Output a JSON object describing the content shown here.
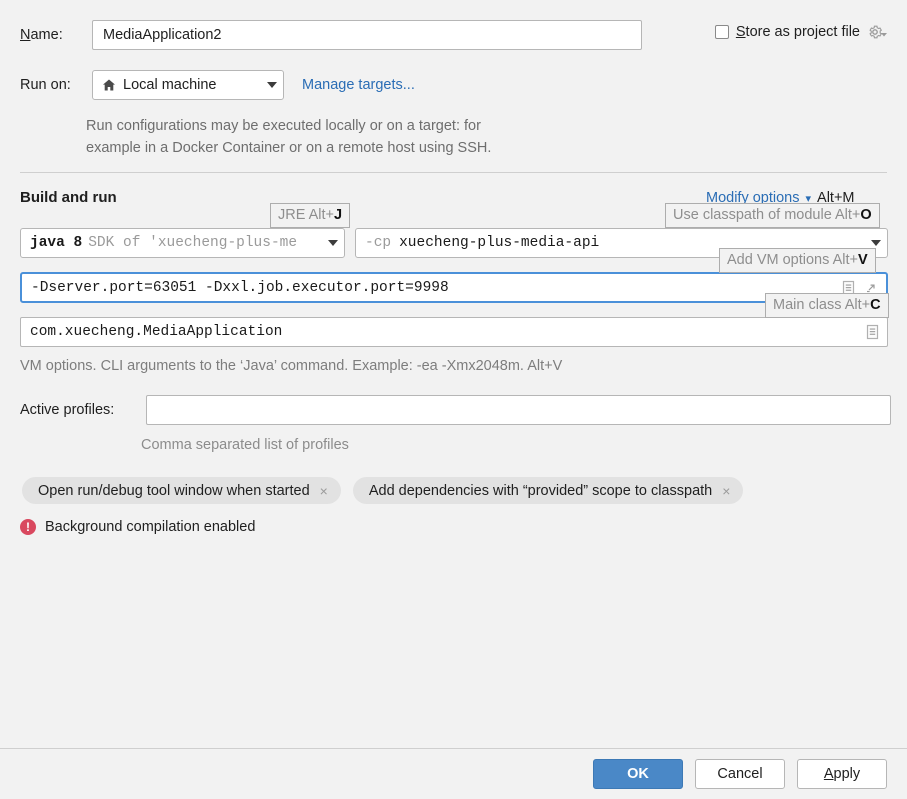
{
  "dialog": {
    "name_label": "Name:",
    "name_value": "MediaApplication2",
    "store_as_project_file": "Store as project file",
    "gear_icon": "gear-icon",
    "run_on_label": "Run on:",
    "run_on_value": "Local machine",
    "run_on_icon": "home-icon",
    "manage_targets": "Manage targets...",
    "helper_line1": "Run configurations may be executed locally or on a target: for",
    "helper_line2": "example in a Docker Container or on a remote host using SSH.",
    "section_title": "Build and run",
    "modify_options": {
      "link": "Modify options",
      "chevron": "chevron-down-icon",
      "shortcut": "Alt+M"
    },
    "jre": {
      "bold": "java 8",
      "dim": "SDK of 'xuecheng-plus-me"
    },
    "classpath": {
      "flag": "-cp",
      "module": "xuecheng-plus-media-api"
    },
    "vm_options_value": "-Dserver.port=63051 -Dxxl.job.executor.port=9998",
    "main_class_value": "com.xuecheng.MediaApplication",
    "vm_hint": "VM options. CLI arguments to the ‘Java’ command. Example: -ea -Xmx2048m. Alt+V",
    "active_profiles_label": "Active profiles:",
    "active_profiles_value": "",
    "active_profiles_hint": "Comma separated list of profiles",
    "chips": [
      {
        "label": "Open run/debug tool window when started",
        "close": "×"
      },
      {
        "label": "Add dependencies with “provided” scope to classpath",
        "close": "×"
      }
    ],
    "warning": {
      "badge": "!",
      "text": "Background compilation enabled"
    },
    "tooltips": {
      "jre": {
        "text": "JRE Alt+",
        "key": "J"
      },
      "classpath": {
        "text": "Use classpath of module Alt+",
        "key": "O"
      },
      "vm_options": {
        "text": "Add VM options Alt+",
        "key": "V"
      },
      "main_class": {
        "text": "Main class Alt+",
        "key": "C"
      }
    },
    "buttons": {
      "ok": "OK",
      "cancel": "Cancel",
      "apply": "Apply"
    },
    "colors": {
      "background": "#f2f2f2",
      "link": "#2a6db5",
      "focus_border": "#4a90d9",
      "primary_button": "#4a88c7",
      "warning": "#d9485f"
    }
  }
}
